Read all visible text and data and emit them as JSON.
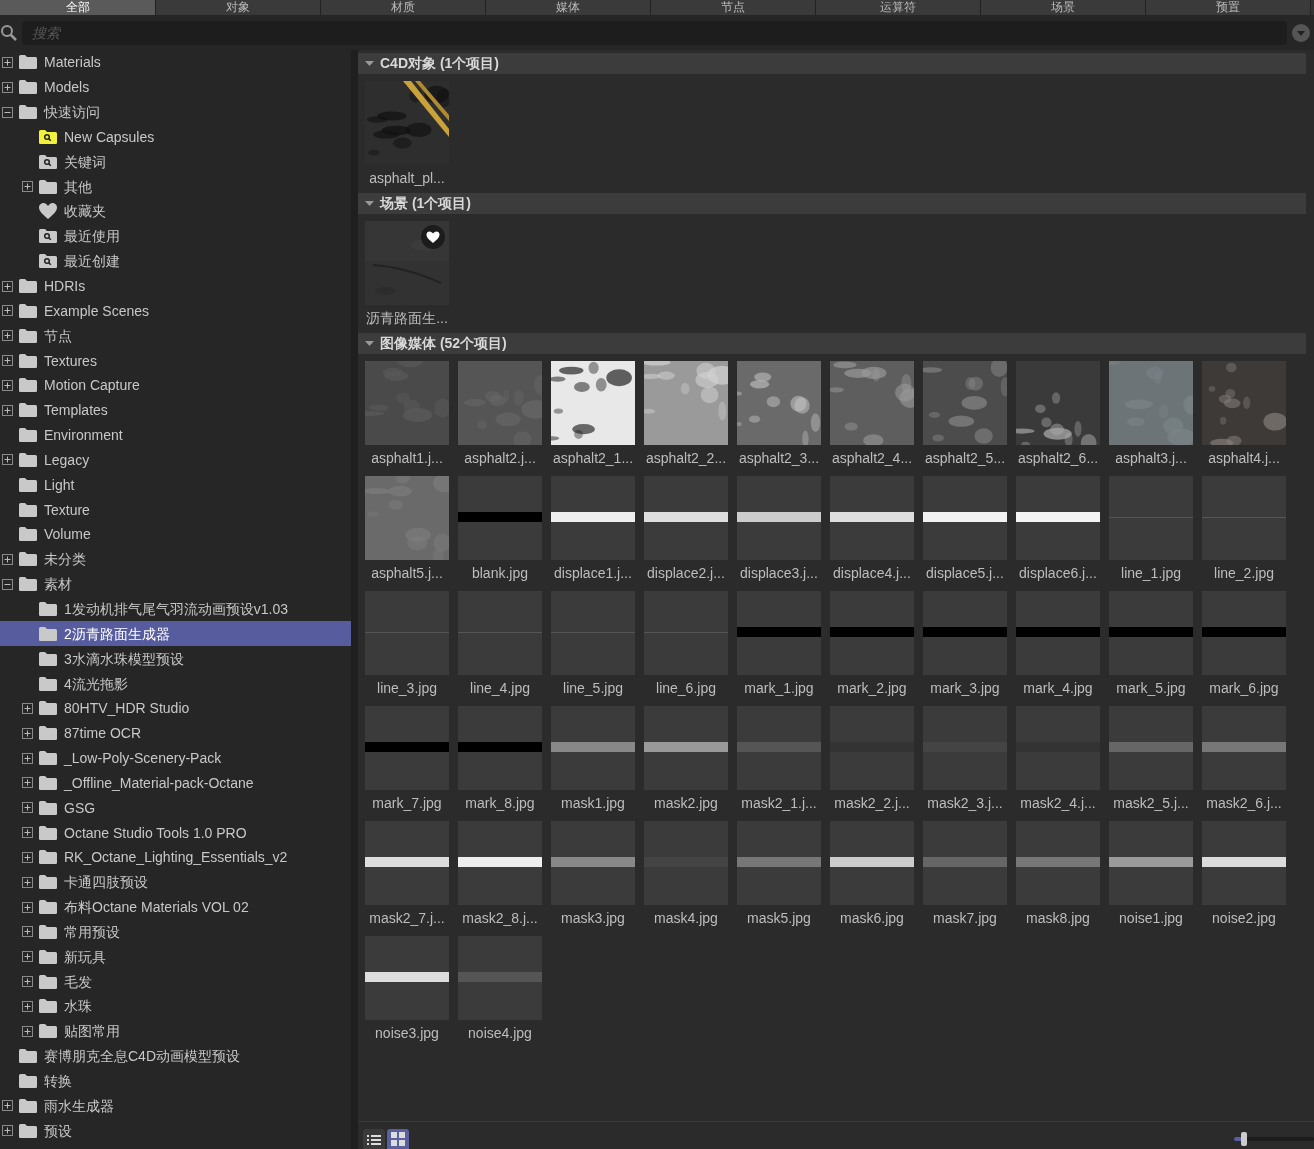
{
  "tabs": [
    {
      "label": "全部",
      "selected": true
    },
    {
      "label": "对象",
      "selected": false
    },
    {
      "label": "材质",
      "selected": false
    },
    {
      "label": "媒体",
      "selected": false
    },
    {
      "label": "节点",
      "selected": false
    },
    {
      "label": "运算符",
      "selected": false
    },
    {
      "label": "场景",
      "selected": false
    },
    {
      "label": "预置",
      "selected": false
    }
  ],
  "search": {
    "placeholder": "搜索"
  },
  "tree": [
    {
      "label": "Materials",
      "kind": "folder",
      "expanded": false,
      "selected": false
    },
    {
      "label": "Models",
      "kind": "folder",
      "expanded": false,
      "selected": false
    },
    {
      "label": "快速访问",
      "kind": "folder",
      "expanded": true,
      "selected": false,
      "children": [
        {
          "label": "New Capsules",
          "kind": "tag",
          "selected": false
        },
        {
          "label": "关键词",
          "kind": "search",
          "selected": false
        },
        {
          "label": "其他",
          "kind": "folder",
          "expanded": false,
          "selected": false
        },
        {
          "label": "收藏夹",
          "kind": "heart",
          "selected": false
        },
        {
          "label": "最近使用",
          "kind": "search",
          "selected": false
        },
        {
          "label": "最近创建",
          "kind": "search",
          "selected": false
        }
      ]
    },
    {
      "label": "HDRIs",
      "kind": "folder",
      "expanded": false,
      "selected": false
    },
    {
      "label": "Example Scenes",
      "kind": "folder",
      "expanded": false,
      "selected": false
    },
    {
      "label": "节点",
      "kind": "folder",
      "expanded": false,
      "selected": false
    },
    {
      "label": "Textures",
      "kind": "folder",
      "expanded": false,
      "selected": false
    },
    {
      "label": "Motion Capture",
      "kind": "folder",
      "expanded": false,
      "selected": false
    },
    {
      "label": "Templates",
      "kind": "folder",
      "expanded": false,
      "selected": false
    },
    {
      "label": "Environment",
      "kind": "folder",
      "selected": false
    },
    {
      "label": "Legacy",
      "kind": "folder",
      "expanded": false,
      "selected": false
    },
    {
      "label": "Light",
      "kind": "folder",
      "selected": false
    },
    {
      "label": "Texture",
      "kind": "folder",
      "selected": false
    },
    {
      "label": "Volume",
      "kind": "folder",
      "selected": false
    },
    {
      "label": "未分类",
      "kind": "folder",
      "expanded": false,
      "selected": false
    },
    {
      "label": "素材",
      "kind": "folder",
      "expanded": true,
      "selected": false,
      "children": [
        {
          "label": "1发动机排气尾气羽流动画预设v1.03",
          "kind": "folder",
          "selected": false
        },
        {
          "label": "2沥青路面生成器",
          "kind": "folder",
          "selected": true
        },
        {
          "label": "3水滴水珠模型预设",
          "kind": "folder",
          "selected": false
        },
        {
          "label": "4流光拖影",
          "kind": "folder",
          "selected": false
        },
        {
          "label": "80HTV_HDR Studio",
          "kind": "folder",
          "expanded": false,
          "selected": false
        },
        {
          "label": "87time OCR",
          "kind": "folder",
          "expanded": false,
          "selected": false
        },
        {
          "label": "_Low-Poly-Scenery-Pack",
          "kind": "folder",
          "expanded": false,
          "selected": false
        },
        {
          "label": "_Offline_Material-pack-Octane",
          "kind": "folder",
          "expanded": false,
          "selected": false
        },
        {
          "label": "GSG",
          "kind": "folder",
          "expanded": false,
          "selected": false
        },
        {
          "label": "Octane Studio Tools 1.0 PRO",
          "kind": "folder",
          "expanded": false,
          "selected": false
        },
        {
          "label": "RK_Octane_Lighting_Essentials_v2",
          "kind": "folder",
          "expanded": false,
          "selected": false
        },
        {
          "label": "卡通四肢预设",
          "kind": "folder",
          "expanded": false,
          "selected": false
        },
        {
          "label": "布料Octane Materials VOL 02",
          "kind": "folder",
          "expanded": false,
          "selected": false
        },
        {
          "label": "常用预设",
          "kind": "folder",
          "expanded": false,
          "selected": false
        },
        {
          "label": "新玩具",
          "kind": "folder",
          "expanded": false,
          "selected": false
        },
        {
          "label": "毛发",
          "kind": "folder",
          "expanded": false,
          "selected": false
        },
        {
          "label": "水珠",
          "kind": "folder",
          "expanded": false,
          "selected": false
        },
        {
          "label": "贴图常用",
          "kind": "folder",
          "expanded": false,
          "selected": false
        }
      ]
    },
    {
      "label": "赛博朋克全息C4D动画模型预设",
      "kind": "folder",
      "selected": false
    },
    {
      "label": "转换",
      "kind": "folder",
      "selected": false
    },
    {
      "label": "雨水生成器",
      "kind": "folder",
      "expanded": false,
      "selected": false
    },
    {
      "label": "预设",
      "kind": "folder",
      "expanded": false,
      "selected": false
    }
  ],
  "sections": [
    {
      "title": "C4D对象 (1个项目)",
      "expanded": true,
      "items": [
        {
          "label": "asphalt_pl...",
          "favorite": false
        }
      ]
    },
    {
      "title": "场景 (1个项目)",
      "expanded": true,
      "items": [
        {
          "label": "沥青路面生...",
          "favorite": true
        }
      ]
    },
    {
      "title": "图像媒体 (52个项目)",
      "expanded": true,
      "items": [
        {
          "label": "asphalt1.j...",
          "favorite": false
        },
        {
          "label": "asphalt2.j...",
          "favorite": false
        },
        {
          "label": "asphalt2_1...",
          "favorite": false
        },
        {
          "label": "asphalt2_2...",
          "favorite": false
        },
        {
          "label": "asphalt2_3...",
          "favorite": false
        },
        {
          "label": "asphalt2_4...",
          "favorite": false
        },
        {
          "label": "asphalt2_5...",
          "favorite": false
        },
        {
          "label": "asphalt2_6...",
          "favorite": false
        },
        {
          "label": "asphalt3.j...",
          "favorite": false
        },
        {
          "label": "asphalt4.j...",
          "favorite": false
        },
        {
          "label": "asphalt5.j...",
          "favorite": false
        },
        {
          "label": "blank.jpg",
          "favorite": false
        },
        {
          "label": "displace1.j...",
          "favorite": false
        },
        {
          "label": "displace2.j...",
          "favorite": false
        },
        {
          "label": "displace3.j...",
          "favorite": false
        },
        {
          "label": "displace4.j...",
          "favorite": false
        },
        {
          "label": "displace5.j...",
          "favorite": false
        },
        {
          "label": "displace6.j...",
          "favorite": false
        },
        {
          "label": "line_1.jpg",
          "favorite": false
        },
        {
          "label": "line_2.jpg",
          "favorite": false
        },
        {
          "label": "line_3.jpg",
          "favorite": false
        },
        {
          "label": "line_4.jpg",
          "favorite": false
        },
        {
          "label": "line_5.jpg",
          "favorite": false
        },
        {
          "label": "line_6.jpg",
          "favorite": false
        },
        {
          "label": "mark_1.jpg",
          "favorite": false
        },
        {
          "label": "mark_2.jpg",
          "favorite": false
        },
        {
          "label": "mark_3.jpg",
          "favorite": false
        },
        {
          "label": "mark_4.jpg",
          "favorite": false
        },
        {
          "label": "mark_5.jpg",
          "favorite": false
        },
        {
          "label": "mark_6.jpg",
          "favorite": false
        },
        {
          "label": "mark_7.jpg",
          "favorite": false
        },
        {
          "label": "mark_8.jpg",
          "favorite": false
        },
        {
          "label": "mask1.jpg",
          "favorite": false
        },
        {
          "label": "mask2.jpg",
          "favorite": false
        },
        {
          "label": "mask2_1.j...",
          "favorite": false
        },
        {
          "label": "mask2_2.j...",
          "favorite": false
        },
        {
          "label": "mask2_3.j...",
          "favorite": false
        },
        {
          "label": "mask2_4.j...",
          "favorite": false
        },
        {
          "label": "mask2_5.j...",
          "favorite": false
        },
        {
          "label": "mask2_6.j...",
          "favorite": false
        },
        {
          "label": "mask2_7.j...",
          "favorite": false
        },
        {
          "label": "mask2_8.j...",
          "favorite": false
        },
        {
          "label": "mask3.jpg",
          "favorite": false
        },
        {
          "label": "mask4.jpg",
          "favorite": false
        },
        {
          "label": "mask5.jpg",
          "favorite": false
        },
        {
          "label": "mask6.jpg",
          "favorite": false
        },
        {
          "label": "mask7.jpg",
          "favorite": false
        },
        {
          "label": "mask8.jpg",
          "favorite": false
        },
        {
          "label": "noise1.jpg",
          "favorite": false
        },
        {
          "label": "noise2.jpg",
          "favorite": false
        },
        {
          "label": "noise3.jpg",
          "favorite": false
        },
        {
          "label": "noise4.jpg",
          "favorite": false
        }
      ]
    }
  ],
  "view_modes": [
    {
      "kind": "list",
      "selected": false
    },
    {
      "kind": "grid",
      "selected": true
    }
  ],
  "zoom_slider": {
    "level": 0.12
  }
}
